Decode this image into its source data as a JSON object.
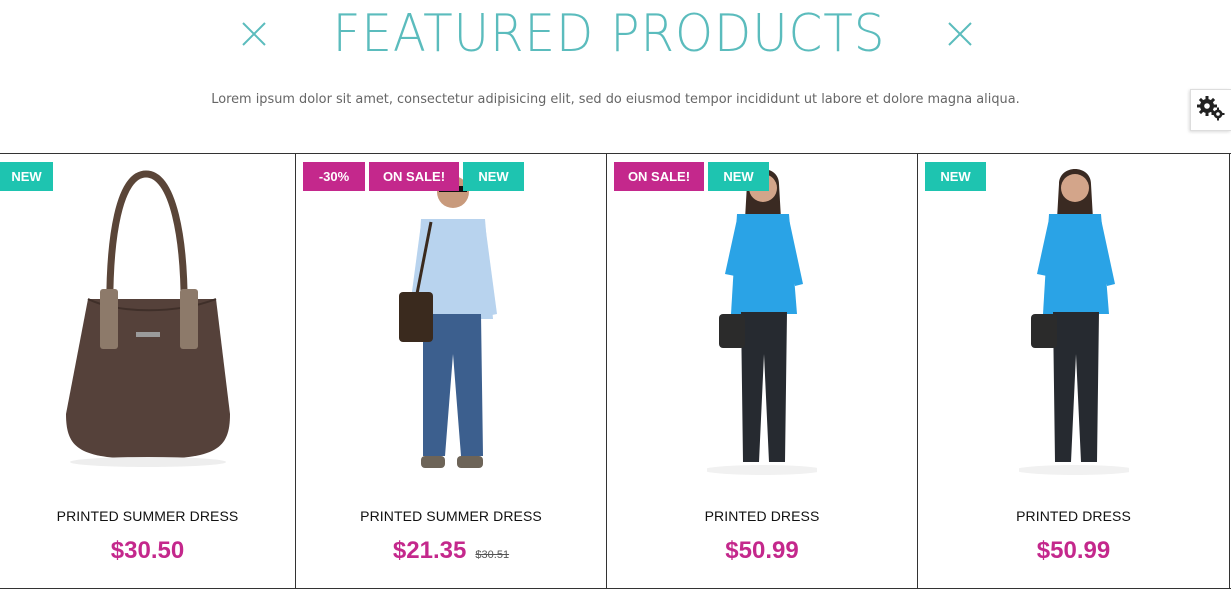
{
  "section": {
    "title": "FEATURED PRODUCTS",
    "subtitle": "Lorem ipsum dolor sit amet, consectetur adipisicing elit, sed do eiusmod tempor incididunt ut labore et dolore magna aliqua."
  },
  "colors": {
    "accent": "#5bbcbd",
    "badge_new": "#1ec4b0",
    "badge_sale": "#c4288c",
    "price": "#c4288c"
  },
  "settings": {
    "icon": "gears-icon"
  },
  "products": [
    {
      "name": "PRINTED SUMMER DRESS",
      "price": "$30.50",
      "old_price": null,
      "badges": [
        "NEW"
      ],
      "image": "brown-handbag"
    },
    {
      "name": "PRINTED SUMMER DRESS",
      "price": "$21.35",
      "old_price": "$30.51",
      "badges": [
        "-30%",
        "ON SALE!",
        "NEW"
      ],
      "image": "man-with-shoulder-bag"
    },
    {
      "name": "PRINTED DRESS",
      "price": "$50.99",
      "old_price": null,
      "badges": [
        "ON SALE!",
        "NEW"
      ],
      "image": "woman-blue-top"
    },
    {
      "name": "PRINTED DRESS",
      "price": "$50.99",
      "old_price": null,
      "badges": [
        "NEW"
      ],
      "image": "woman-blue-top"
    }
  ]
}
